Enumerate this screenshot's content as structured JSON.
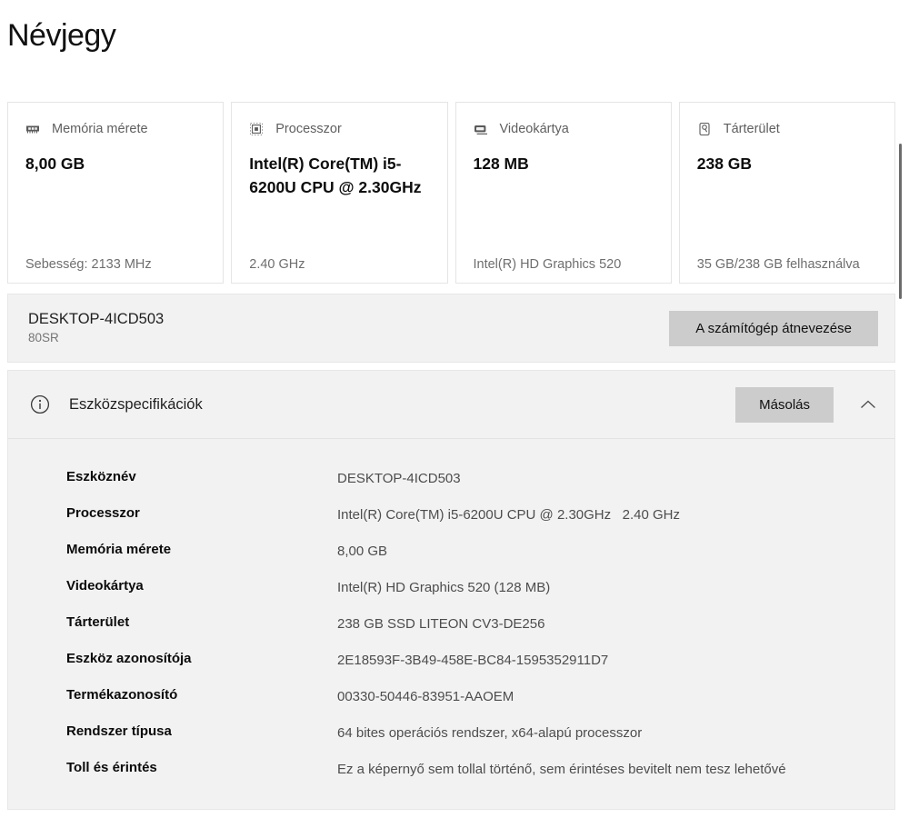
{
  "page": {
    "title": "Névjegy"
  },
  "cards": [
    {
      "icon": "memory-icon",
      "label": "Memória mérete",
      "value": "8,00 GB",
      "footer": "Sebesség: 2133 MHz"
    },
    {
      "icon": "cpu-icon",
      "label": "Processzor",
      "value": "Intel(R) Core(TM) i5-6200U CPU @ 2.30GHz",
      "footer": "2.40 GHz"
    },
    {
      "icon": "gpu-icon",
      "label": "Videokártya",
      "value": "128 MB",
      "footer": "Intel(R) HD Graphics 520"
    },
    {
      "icon": "storage-icon",
      "label": "Tárterület",
      "value": "238 GB",
      "footer": "35 GB/238 GB felhasználva"
    }
  ],
  "computer": {
    "name": "DESKTOP-4ICD503",
    "model": "80SR",
    "rename_button": "A számítógép átnevezése"
  },
  "specs": {
    "title": "Eszközspecifikációk",
    "copy_button": "Másolás",
    "rows": [
      {
        "label": "Eszköznév",
        "value": "DESKTOP-4ICD503"
      },
      {
        "label": "Processzor",
        "value": "Intel(R) Core(TM) i5-6200U CPU @ 2.30GHz   2.40 GHz"
      },
      {
        "label": "Memória mérete",
        "value": "8,00 GB"
      },
      {
        "label": "Videokártya",
        "value": "Intel(R) HD Graphics 520 (128 MB)"
      },
      {
        "label": "Tárterület",
        "value": "238 GB SSD LITEON CV3-DE256"
      },
      {
        "label": "Eszköz azonosítója",
        "value": "2E18593F-3B49-458E-BC84-1595352911D7"
      },
      {
        "label": "Termékazonosító",
        "value": "00330-50446-83951-AAOEM"
      },
      {
        "label": "Rendszer típusa",
        "value": "64 bites operációs rendszer, x64-alapú processzor"
      },
      {
        "label": "Toll és érintés",
        "value": "Ez a képernyő sem tollal történő, sem érintéses bevitelt nem tesz lehetővé"
      }
    ]
  },
  "colors": {
    "panel_bg": "#f2f2f2",
    "button_bg": "#cccccc",
    "card_border": "#e5e5e5",
    "muted_text": "#5f5f5f"
  }
}
